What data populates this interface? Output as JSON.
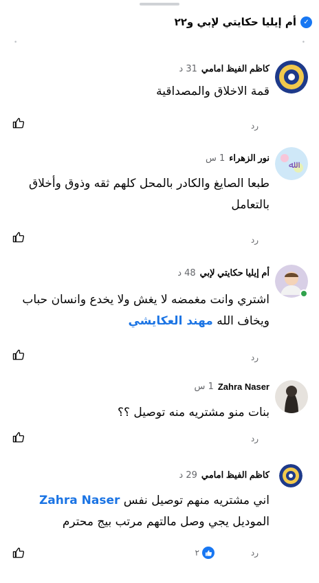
{
  "page": {
    "title": "أم إيليا حكايتي لإبي و٢٢"
  },
  "comments": [
    {
      "name": "كاظم الفيظ امامي",
      "time": "31 د",
      "text": "قمة الاخلاق والمصداقية",
      "reply": "رد"
    },
    {
      "name": "نور الزهراء",
      "time": "1 س",
      "text": "طبعا الصايغ والكادر بالمحل كلهم ثقه وذوق وأخلاق بالتعامل",
      "reply": "رد"
    },
    {
      "name": "أم إيليا حكايتي لإبي",
      "time": "48 د",
      "text": "اشتري وانت مغمضه لا يغش ولا يخدع وانسان حباب ويخاف الله",
      "mention": "مهند العكايشي",
      "reply": "رد"
    },
    {
      "name": "Zahra Naser",
      "time": "1 س",
      "text": "بنات منو مشتريه منه توصيل ؟؟",
      "reply": "رد"
    },
    {
      "name": "كاظم الفيظ امامي",
      "time": "29 د",
      "mention": "Zahra Naser",
      "text_after_mention": "اني مشتريه منهم توصيل نفس",
      "text_line2": "الموديل يجي وصل مالتهم مرتب بيج محترم",
      "reply": "رد",
      "reaction_count": "٢"
    }
  ],
  "icons": {
    "verified": "verified-badge-icon",
    "like": "thumbs-up-icon",
    "reaction": "like-reaction-icon"
  },
  "colors": {
    "accent": "#1877f2",
    "mention": "#1b74e4",
    "meta": "#65676b",
    "online": "#31a24c"
  }
}
